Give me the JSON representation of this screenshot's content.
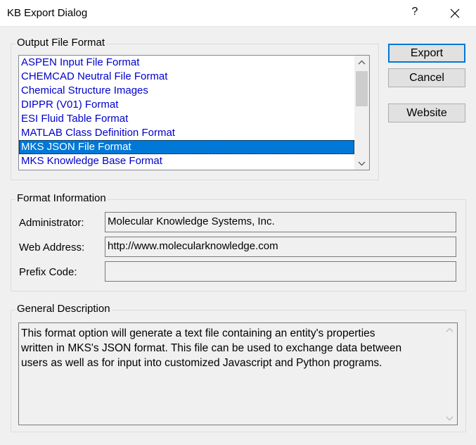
{
  "window": {
    "title": "KB Export Dialog",
    "help_glyph": "?"
  },
  "output_format": {
    "group_label": "Output File Format",
    "items": [
      {
        "label": "ASPEN Input File Format",
        "selected": false
      },
      {
        "label": "CHEMCAD Neutral File Format",
        "selected": false
      },
      {
        "label": "Chemical Structure Images",
        "selected": false
      },
      {
        "label": "DIPPR (V01) Format",
        "selected": false
      },
      {
        "label": "ESI Fluid Table Format",
        "selected": false
      },
      {
        "label": "MATLAB Class Definition Format",
        "selected": false
      },
      {
        "label": "MKS JSON File Format",
        "selected": true
      },
      {
        "label": "MKS Knowledge Base Format",
        "selected": false
      }
    ]
  },
  "buttons": {
    "export": "Export",
    "cancel": "Cancel",
    "website": "Website"
  },
  "format_info": {
    "group_label": "Format Information",
    "administrator_label": "Administrator:",
    "administrator_value": "Molecular Knowledge Systems, Inc.",
    "web_address_label": "Web Address:",
    "web_address_value": "http://www.molecularknowledge.com",
    "prefix_code_label": "Prefix Code:",
    "prefix_code_value": ""
  },
  "general_description": {
    "group_label": "General Description",
    "text": "This format option will generate a text file containing an entity's properties\nwritten in MKS's JSON format. This file can be used to exchange data between\nusers as well as for input into customized Javascript and Python programs."
  },
  "colors": {
    "list_item_text": "#0000cc",
    "selection": "#0078d7",
    "default_button_border": "#0078d7"
  }
}
